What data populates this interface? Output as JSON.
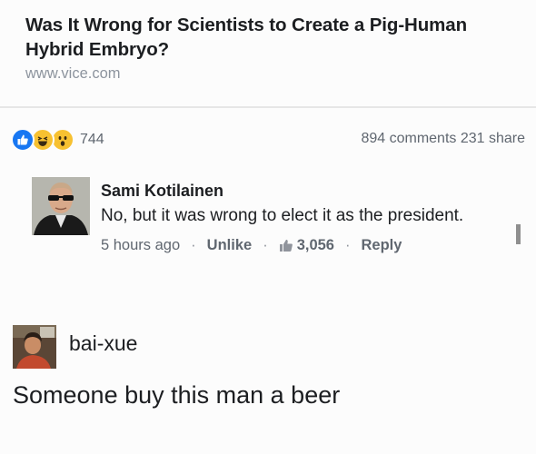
{
  "link_card": {
    "title": "Was It Wrong for Scientists to Create a Pig-Human Hybrid Embryo?",
    "domain": "www.vice.com"
  },
  "stats": {
    "reaction_icons": [
      "like-icon",
      "laughing-face-icon",
      "surprised-face-icon"
    ],
    "reaction_count": "744",
    "comments_shares": "894 comments 231 share"
  },
  "comment": {
    "author": "Sami Kotilainen",
    "text": "No, but it was wrong to elect it as the president.",
    "time": "5 hours ago",
    "unlike_label": "Unlike",
    "like_count": "3,056",
    "reply_label": "Reply",
    "separator": "·"
  },
  "reply": {
    "username": "bai-xue",
    "text": "Someone buy this man a beer"
  },
  "colors": {
    "like_blue": "#1877f2",
    "emoji_yellow": "#f7c131",
    "meta_gray": "#606770"
  }
}
